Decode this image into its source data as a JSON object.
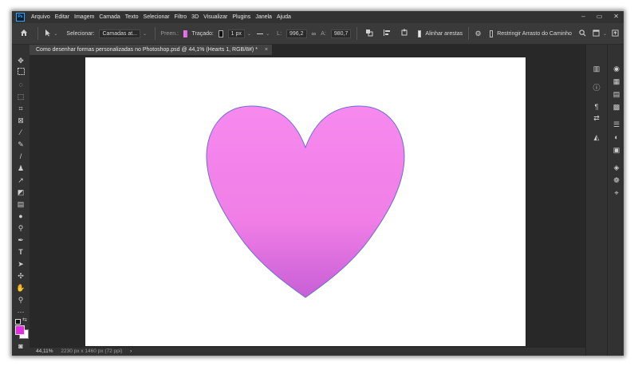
{
  "menu": {
    "logo": "Ps",
    "items": [
      "Arquivo",
      "Editar",
      "Imagem",
      "Camada",
      "Texto",
      "Selecionar",
      "Filtro",
      "3D",
      "Visualizar",
      "Plugins",
      "Janela",
      "Ajuda"
    ],
    "window_controls": [
      "–",
      "▭",
      "✕"
    ]
  },
  "options": {
    "select_label": "Selecionar:",
    "select_value": "Camadas at...",
    "fill_label": "Preen.:",
    "fill_color": "#ee82ee",
    "stroke_label": "Traçado:",
    "stroke_width": "1 px",
    "width_label": "L:",
    "width_value": "996,2",
    "height_label": "A:",
    "height_value": "980,7",
    "align_edges_label": "Alinhar arestas",
    "align_edges_checked": true,
    "constrain_label": "Restringir Arrasto do Caminho",
    "constrain_checked": false
  },
  "document": {
    "tab_title": "Como desenhar formas personalizadas no Photoshop.psd @ 44,1% (Hearts 1, RGB/8#) *",
    "tab_close": "×",
    "shape_top_color": "#f689ef",
    "shape_bottom_color": "#c85fd6",
    "shape_stroke_color": "#6b6fd3"
  },
  "status": {
    "zoom": "44,11%",
    "dimensions": "2230 px x 1460 px (72 ppi)",
    "arrow": "›"
  },
  "colors": {
    "foreground": "#e02ee0",
    "background": "#ffffff"
  }
}
